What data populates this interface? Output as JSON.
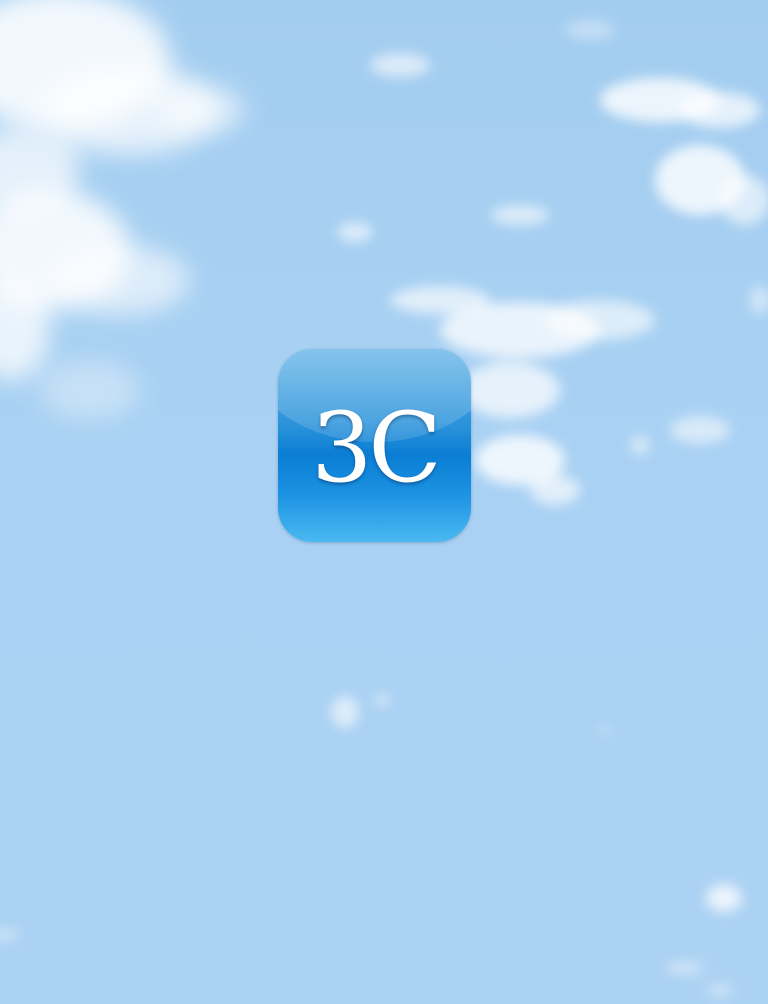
{
  "screen": {
    "background_color": "#a9d1f3"
  },
  "app_icon": {
    "label": "3C",
    "gradient_top": "#5fb2e6",
    "gradient_mid": "#0a7ed4",
    "gradient_bottom": "#4ab9f1"
  }
}
